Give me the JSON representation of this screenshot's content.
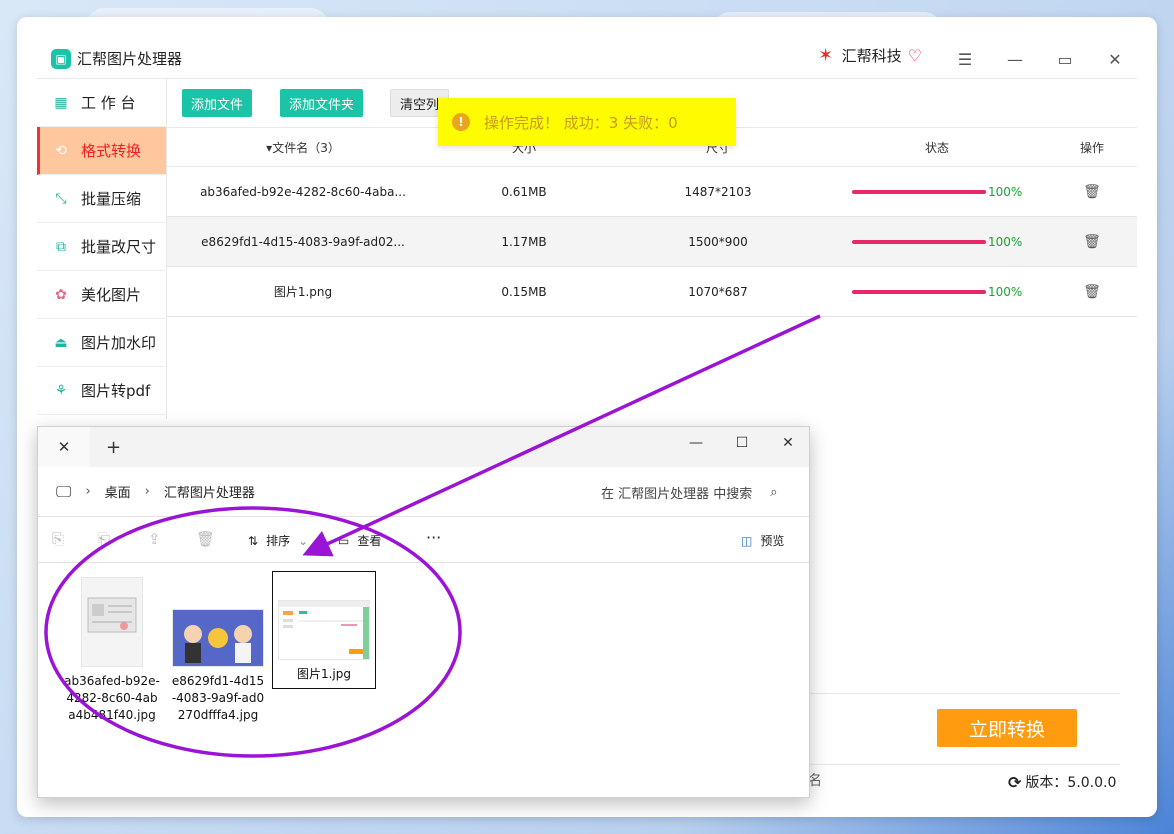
{
  "app": {
    "title": "汇帮图片处理器",
    "brand": "汇帮科技",
    "sidebar": [
      {
        "label": "工 作 台",
        "icon": "grid-icon"
      },
      {
        "label": "格式转换",
        "icon": "convert-icon",
        "active": true
      },
      {
        "label": "批量压缩",
        "icon": "compress-icon"
      },
      {
        "label": "批量改尺寸",
        "icon": "resize-icon"
      },
      {
        "label": "美化图片",
        "icon": "beautify-icon"
      },
      {
        "label": "图片加水印",
        "icon": "watermark-icon"
      },
      {
        "label": "图片转pdf",
        "icon": "pdf-icon"
      }
    ],
    "toolbar": {
      "add_file": "添加文件",
      "add_folder": "添加文件夹",
      "clear_list": "清空列"
    },
    "toast": "操作完成！ 成功：3   失败：0",
    "table": {
      "headers": {
        "name": "文件名（3）",
        "size": "大小",
        "dimension": "尺寸",
        "status": "状态",
        "action": "操作"
      },
      "rows": [
        {
          "name": "ab36afed-b92e-4282-8c60-4aba...",
          "size": "0.61MB",
          "dimension": "1487*2103",
          "progress": "100%"
        },
        {
          "name": "e8629fd1-4d15-4083-9a9f-ad02...",
          "size": "1.17MB",
          "dimension": "1500*900",
          "progress": "100%"
        },
        {
          "name": "图片1.png",
          "size": "0.15MB",
          "dimension": "1070*687",
          "progress": "100%"
        }
      ]
    },
    "convert_button": "立即转换",
    "version": "版本：5.0.0.0",
    "stub_char": "名"
  },
  "explorer": {
    "breadcrumb": [
      "桌面",
      "汇帮图片处理器"
    ],
    "search_placeholder": "在 汇帮图片处理器 中搜索",
    "sort_label": "排序",
    "view_label": "查看",
    "more_label": "···",
    "preview_label": "预览",
    "files": [
      {
        "name": "ab36afed-b92e-4282-8c60-4aba4b481f40.jpg"
      },
      {
        "name": "e8629fd1-4d15-4083-9a9f-ad0270dfffa4.jpg"
      },
      {
        "name": "图片1.jpg",
        "selected": true
      }
    ]
  },
  "colors": {
    "accent_teal": "#1bc3a7",
    "active_bg": "#ffc79e",
    "progress": "#e8286a",
    "convert": "#ff9b0f",
    "toast_bg": "#fffb00",
    "annotation": "#9b14d6"
  }
}
